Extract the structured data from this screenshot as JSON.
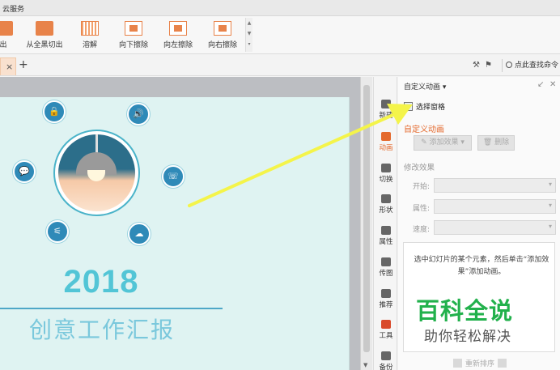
{
  "menu": {
    "cloud_service": "云服务"
  },
  "ribbon": {
    "items": [
      {
        "label": "出",
        "icon": "cut-out-icon"
      },
      {
        "label": "从全黑切出",
        "icon": "fade-black-icon"
      },
      {
        "label": "溶解",
        "icon": "dissolve-icon"
      },
      {
        "label": "向下擦除",
        "icon": "wipe-down-icon"
      },
      {
        "label": "向左擦除",
        "icon": "wipe-left-icon"
      },
      {
        "label": "向右擦除",
        "icon": "wipe-right-icon"
      }
    ]
  },
  "tabs": {
    "close": "×",
    "add": "+"
  },
  "search": {
    "label": "点此查找命令"
  },
  "slide": {
    "year": "2018",
    "title": "创意工作汇报",
    "icons": [
      "lock-icon",
      "speaker-icon",
      "chat-icon",
      "phone-icon",
      "sliders-icon",
      "cloud-upload-icon"
    ]
  },
  "side_toolbar": {
    "items": [
      "新建",
      "动画",
      "切换",
      "形状",
      "属性",
      "传图",
      "推荐",
      "工具",
      "备份"
    ]
  },
  "pane": {
    "title": "自定义动画",
    "title_caret": "▾",
    "pick_pane": "选择窗格",
    "section": "自定义动画",
    "add_effect": "添加效果",
    "add_caret": "▾",
    "delete": "删除",
    "modify_effect": "修改效果",
    "start": "开始:",
    "property": "属性:",
    "speed": "速度:",
    "hint": "选中幻灯片的某个元素，然后单击“添加效果”添加动画。",
    "reorder": "重新排序"
  },
  "watermark": {
    "line1": "百科全说",
    "line2": "助你轻松解决"
  },
  "colors": {
    "accent_orange": "#e46a2e",
    "slide_bg": "#dff3f2",
    "year": "#52c5d6",
    "arrow": "#f4f44a",
    "brand_green": "#22b14c"
  }
}
